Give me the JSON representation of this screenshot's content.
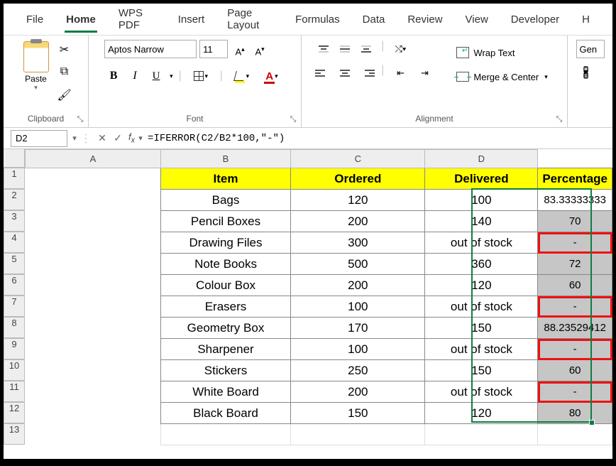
{
  "tabs": {
    "file": "File",
    "home": "Home",
    "wps": "WPS PDF",
    "insert": "Insert",
    "page_layout": "Page Layout",
    "formulas": "Formulas",
    "data": "Data",
    "review": "Review",
    "view": "View",
    "developer": "Developer",
    "help": "H"
  },
  "ribbon": {
    "clipboard": {
      "paste": "Paste",
      "label": "Clipboard"
    },
    "font": {
      "name": "Aptos Narrow",
      "size": "11",
      "label": "Font"
    },
    "alignment": {
      "wrap": "Wrap Text",
      "merge": "Merge & Center",
      "label": "Alignment"
    },
    "number": {
      "format_partial": "Gen"
    }
  },
  "formula_bar": {
    "name_box": "D2",
    "formula": "=IFERROR(C2/B2*100,\"-\")"
  },
  "columns": [
    "A",
    "B",
    "C",
    "D"
  ],
  "headers": {
    "item": "Item",
    "ordered": "Ordered",
    "delivered": "Delivered",
    "percentage": "Percentage"
  },
  "rows": [
    {
      "r": 2,
      "item": "Bags",
      "ordered": "120",
      "delivered": "100",
      "pct": "83.33333333",
      "first": true
    },
    {
      "r": 3,
      "item": "Pencil Boxes",
      "ordered": "200",
      "delivered": "140",
      "pct": "70"
    },
    {
      "r": 4,
      "item": "Drawing Files",
      "ordered": "300",
      "delivered": "out of stock",
      "pct": "-",
      "highlight": true
    },
    {
      "r": 5,
      "item": "Note Books",
      "ordered": "500",
      "delivered": "360",
      "pct": "72"
    },
    {
      "r": 6,
      "item": "Colour Box",
      "ordered": "200",
      "delivered": "120",
      "pct": "60"
    },
    {
      "r": 7,
      "item": "Erasers",
      "ordered": "100",
      "delivered": "out of stock",
      "pct": "-",
      "highlight": true
    },
    {
      "r": 8,
      "item": "Geometry Box",
      "ordered": "170",
      "delivered": "150",
      "pct": "88.23529412"
    },
    {
      "r": 9,
      "item": "Sharpener",
      "ordered": "100",
      "delivered": "out of stock",
      "pct": "-",
      "highlight": true
    },
    {
      "r": 10,
      "item": "Stickers",
      "ordered": "250",
      "delivered": "150",
      "pct": "60"
    },
    {
      "r": 11,
      "item": "White Board",
      "ordered": "200",
      "delivered": "out of stock",
      "pct": "-",
      "highlight": true
    },
    {
      "r": 12,
      "item": "Black Board",
      "ordered": "150",
      "delivered": "120",
      "pct": "80"
    }
  ],
  "chart_data": {
    "type": "table",
    "title": "Delivery percentage via IFERROR",
    "columns": [
      "Item",
      "Ordered",
      "Delivered",
      "Percentage"
    ],
    "rows": [
      [
        "Bags",
        120,
        100,
        83.33333333
      ],
      [
        "Pencil Boxes",
        200,
        140,
        70
      ],
      [
        "Drawing Files",
        300,
        "out of stock",
        "-"
      ],
      [
        "Note Books",
        500,
        360,
        72
      ],
      [
        "Colour Box",
        200,
        120,
        60
      ],
      [
        "Erasers",
        100,
        "out of stock",
        "-"
      ],
      [
        "Geometry Box",
        170,
        150,
        88.23529412
      ],
      [
        "Sharpener",
        100,
        "out of stock",
        "-"
      ],
      [
        "Stickers",
        250,
        150,
        60
      ],
      [
        "White Board",
        200,
        "out of stock",
        "-"
      ],
      [
        "Black Board",
        150,
        120,
        80
      ]
    ]
  }
}
